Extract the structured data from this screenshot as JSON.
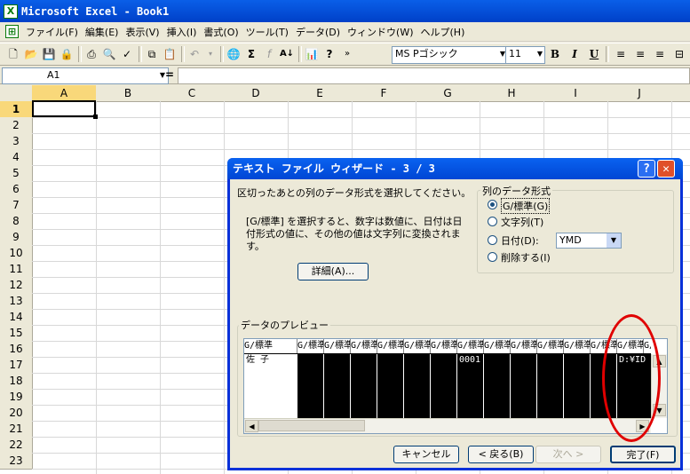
{
  "app": {
    "title": "Microsoft Excel - Book1"
  },
  "menu": [
    "ファイル(F)",
    "編集(E)",
    "表示(V)",
    "挿入(I)",
    "書式(O)",
    "ツール(T)",
    "データ(D)",
    "ウィンドウ(W)",
    "ヘルプ(H)"
  ],
  "toolbar": {
    "font": "MS Pゴシック",
    "size": "11",
    "bold": "B",
    "italic": "I",
    "underline": "U"
  },
  "formula": {
    "cell_ref": "A1",
    "equals": "=",
    "value": ""
  },
  "grid": {
    "columns": [
      "A",
      "B",
      "C",
      "D",
      "E",
      "F",
      "G",
      "H",
      "I",
      "J"
    ],
    "rows": [
      "1",
      "2",
      "3",
      "4",
      "5",
      "6",
      "7",
      "8",
      "9",
      "10",
      "11",
      "12",
      "13",
      "14",
      "15",
      "16",
      "17",
      "18",
      "19",
      "20",
      "21",
      "22",
      "23"
    ]
  },
  "dialog": {
    "title": "テキスト ファイル ウィザード - 3 / 3",
    "help": "?",
    "close": "✕",
    "instruction": "区切ったあとの列のデータ形式を選択してください。",
    "description_line1": "[G/標準] を選択すると、数字は数値に、日付は日",
    "description_line2": "付形式の値に、その他の値は文字列に変換されま",
    "description_line3": "す。",
    "details_button": "詳細(A)...",
    "group_label": "列のデータ形式",
    "radios": [
      {
        "label": "G/標準(G)",
        "checked": true
      },
      {
        "label": "文字列(T)",
        "checked": false
      },
      {
        "label": "日付(D):",
        "checked": false
      },
      {
        "label": "削除する(I)",
        "checked": false
      }
    ],
    "date_format": "YMD",
    "preview_label": "データのプレビュー",
    "preview_headers": [
      "G/標準",
      "G/標準",
      "G/標準",
      "G/標準",
      "G/標準",
      "G/標準",
      "G/標準",
      "G/標準",
      "G/標準",
      "G/標準",
      "G/標準",
      "G/標準",
      "G/標準",
      "G/標準",
      "G/標準"
    ],
    "preview_row": [
      "佐 子",
      "",
      "",
      "",
      "",
      "",
      "",
      "0001",
      "",
      "",
      "",
      "",
      "",
      "",
      "D:¥ID"
    ],
    "buttons": {
      "cancel": "キャンセル",
      "back": "< 戻る(B)",
      "next": "次へ >",
      "finish": "完了(F)"
    }
  }
}
